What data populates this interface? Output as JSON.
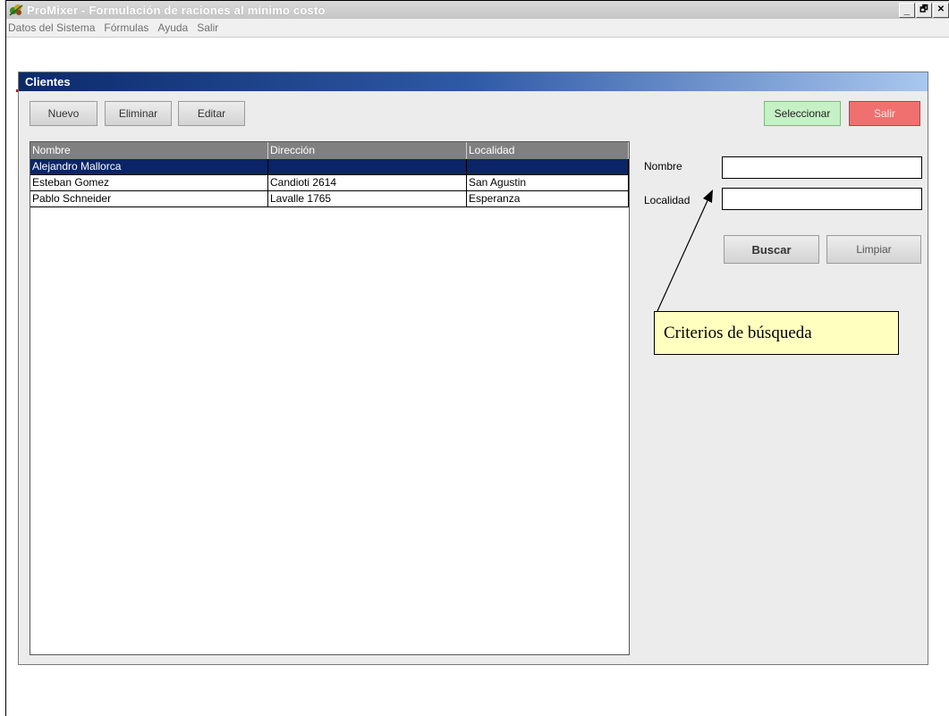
{
  "titlebar": {
    "title": "ProMixer - Formulación de raciones al mínimo costo",
    "min_label": "_",
    "max_label": "🗗",
    "close_label": "✕"
  },
  "menu": {
    "items": [
      "Datos del Sistema",
      "Fórmulas",
      "Ayuda",
      "Salir"
    ]
  },
  "window": {
    "title": "Clientes"
  },
  "toolbar": {
    "nuevo": "Nuevo",
    "eliminar": "Eliminar",
    "editar": "Editar",
    "seleccionar": "Seleccionar",
    "salir": "Salir"
  },
  "table": {
    "columns": [
      "Nombre",
      "Dirección",
      "Localidad"
    ],
    "rows": [
      [
        "Alejandro Mallorca",
        "",
        ""
      ],
      [
        "Esteban Gomez",
        "Candioti 2614",
        "San Agustin"
      ],
      [
        "Pablo Schneider",
        "Lavalle 1765",
        "Esperanza"
      ]
    ],
    "selected_row": 0
  },
  "search": {
    "nombre_label": "Nombre",
    "localidad_label": "Localidad",
    "nombre_value": "",
    "localidad_value": "",
    "buscar": "Buscar",
    "limpiar": "Limpiar"
  },
  "callout": {
    "text": "Criterios de búsqueda"
  },
  "colors": {
    "selection": "#0b2466",
    "header": "#808080",
    "seleccionar_bg": "#c6f0c6",
    "salir_bg": "#f07070",
    "callout_bg": "#ffffc0"
  }
}
